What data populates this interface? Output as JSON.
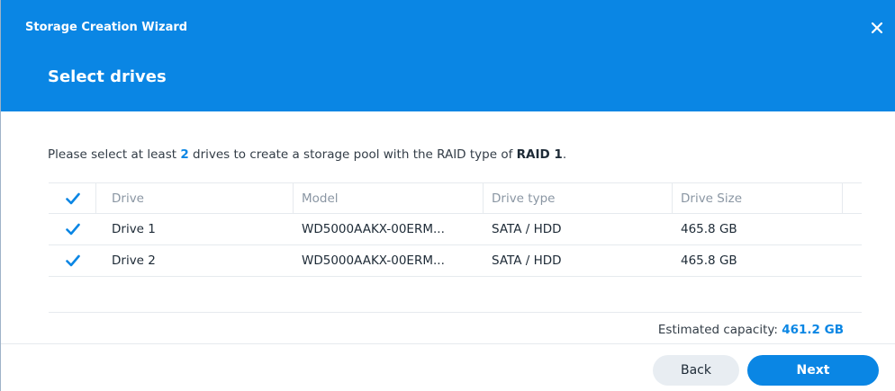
{
  "window": {
    "title": "Storage Creation Wizard",
    "step_title": "Select drives"
  },
  "instruction": {
    "part1": "Please select at least ",
    "min_drives": "2",
    "part2": " drives to create a storage pool with the RAID type of ",
    "raid_type": "RAID 1",
    "part3": "."
  },
  "table": {
    "columns": [
      "Drive",
      "Model",
      "Drive type",
      "Drive Size"
    ],
    "header_checked": true,
    "rows": [
      {
        "checked": true,
        "drive": "Drive 1",
        "model": "WD5000AAKX-00ERM...",
        "type": "SATA / HDD",
        "size": "465.8 GB"
      },
      {
        "checked": true,
        "drive": "Drive 2",
        "model": "WD5000AAKX-00ERM...",
        "type": "SATA / HDD",
        "size": "465.8 GB"
      }
    ]
  },
  "capacity": {
    "label": "Estimated capacity: ",
    "value": "461.2 GB"
  },
  "buttons": {
    "back": "Back",
    "next": "Next"
  },
  "colors": {
    "accent": "#0a86e4",
    "header_bg": "#0a86e4"
  },
  "icons": {
    "close": "close-icon",
    "checkbox": "checkmark-icon"
  }
}
